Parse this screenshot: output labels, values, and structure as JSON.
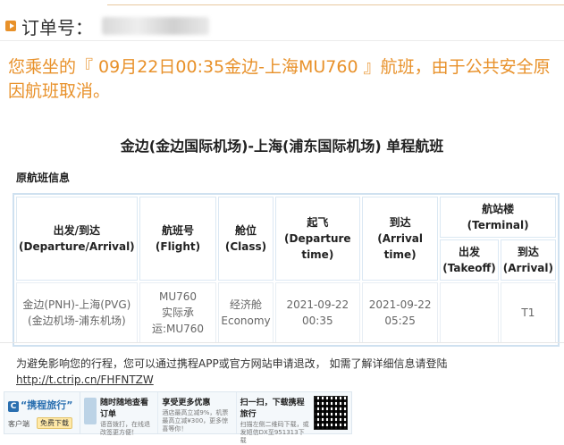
{
  "order": {
    "label": "订单号："
  },
  "notice": "您乘坐的『 09月22日00:35金边-上海MU760 』航班，由于公共安全原因航班取消。",
  "title": "金边(金边国际机场)-上海(浦东国际机场) 单程航班",
  "section_title": "原航班信息",
  "table": {
    "headers": {
      "route": "出发/到达",
      "route_en": "(Departure/Arrival)",
      "flight": "航班号",
      "flight_en": "(Flight)",
      "class": "舱位",
      "class_en": "(Class)",
      "dep": "起飞",
      "dep_en": "(Departure time)",
      "arr": "到达",
      "arr_en": "(Arrival time)",
      "terminal": "航站楼",
      "terminal_en": "(Terminal)",
      "takeoff": "出发",
      "takeoff_en": "(Takeoff)",
      "arrival": "到达",
      "arrival_en": "(Arrival)"
    },
    "row": {
      "route": "金边(PNH)-上海(PVG)",
      "route_sub": "(金边机场-浦东机场)",
      "flight": "MU760",
      "flight_sub": "实际承运:MU760",
      "class": "经济舱",
      "class_en": "Economy",
      "dep": "2021-09-22 00:35",
      "arr": "2021-09-22 05:25",
      "t_takeoff": "",
      "t_arrival": "T1"
    }
  },
  "footer": {
    "text": "为避免影响您的行程，您可以通过携程APP或官方网站申请退改，  如需了解详细信息请登陆",
    "link": "http://t.ctrip.cn/FHFNTZW"
  },
  "banner": {
    "brand": "“携程旅行”",
    "client": "客户端",
    "free": "免费下载",
    "col1_title": "随时随地查看订单",
    "col1_sub": "语音拨打，在线退改签更方便！",
    "col2_title": "享受更多优惠",
    "col2_sub": "酒店最高立减9%，机票最高立减¥300，更多惊喜等你！",
    "col3_title": "扫一扫，下载携程旅行",
    "col3_sub": "扫描左侧二维码下载，或发短信DX至951313下载"
  }
}
